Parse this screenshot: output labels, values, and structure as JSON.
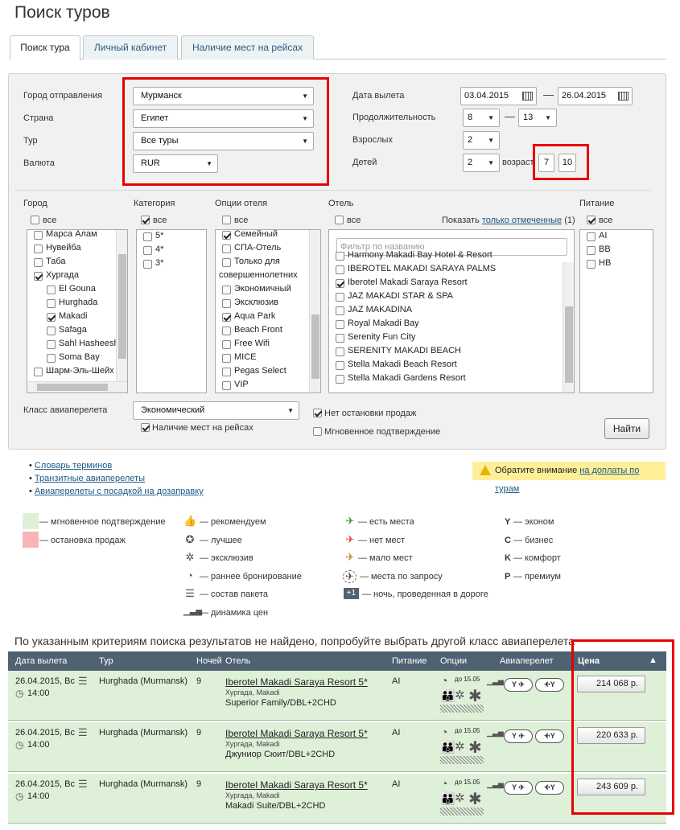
{
  "page": {
    "title": "Поиск туров"
  },
  "tabs": [
    "Поиск тура",
    "Личный кабинет",
    "Наличие мест на рейсах"
  ],
  "form": {
    "city_label": "Город отправления",
    "city_value": "Мурманск",
    "country_label": "Страна",
    "country_value": "Египет",
    "tour_label": "Тур",
    "tour_value": "Все туры",
    "currency_label": "Валюта",
    "currency_value": "RUR",
    "date_label": "Дата вылета",
    "date_from": "03.04.2015",
    "date_to": "26.04.2015",
    "duration_label": "Продолжительность",
    "duration_from": "8",
    "duration_to": "13",
    "adults_label": "Взрослых",
    "adults_value": "2",
    "children_label": "Детей",
    "children_value": "2",
    "age_label": "возраст",
    "age1": "7",
    "age2": "10",
    "dash": "—"
  },
  "filters": {
    "city": {
      "label": "Город",
      "all": "все",
      "items": [
        "Марса Алам",
        "Нувейба",
        "Таба",
        "Хургада",
        "El Gouna",
        "Hurghada",
        "Makadi",
        "Safaga",
        "Sahl Hasheesh",
        "Soma Bay",
        "Шарм-Эль-Шейх"
      ],
      "checked": [
        false,
        false,
        false,
        true,
        false,
        false,
        true,
        false,
        false,
        false,
        false
      ]
    },
    "category": {
      "label": "Категория",
      "all": "все",
      "items": [
        "5*",
        "4*",
        "3*"
      ],
      "checked": [
        false,
        false,
        false
      ]
    },
    "options": {
      "label": "Опции отеля",
      "all": "все",
      "items": [
        "Семейный",
        "СПА-Отель",
        "Только для",
        "совершеннолетних",
        "Экономичный",
        "Эксклюзив",
        "Aqua Park",
        "Beach Front",
        "Free Wifi",
        "MICE",
        "Pegas Select",
        "VIP"
      ],
      "checked": [
        true,
        false,
        false,
        false,
        false,
        false,
        true,
        false,
        false,
        false,
        false,
        false
      ]
    },
    "hotel": {
      "label": "Отель",
      "all": "все",
      "show_prefix": "Показать",
      "show_link": "только отмеченные",
      "show_count": "(1)",
      "filter_placeholder": "Фильтр по названию",
      "items": [
        "Harmony Makadi Bay Hotel & Resort",
        "IBEROTEL MAKADI SARAYA PALMS",
        "Iberotel Makadi Saraya Resort",
        "JAZ MAKADI STAR & SPA",
        "JAZ MAKADINA",
        "Royal Makadi Bay",
        "Serenity Fun City",
        "SERENITY MAKADI BEACH",
        "Stella Makadi Beach Resort",
        "Stella Makadi Gardens Resort"
      ],
      "checked": [
        false,
        false,
        true,
        false,
        false,
        false,
        false,
        false,
        false,
        false
      ]
    },
    "meal": {
      "label": "Питание",
      "all": "все",
      "items": [
        "AI",
        "BB",
        "HB"
      ],
      "checked": [
        false,
        false,
        false
      ]
    }
  },
  "flight": {
    "label": "Класс авиаперелета",
    "value": "Экономический",
    "availability": "Наличие мест на рейсах",
    "no_stop": "Нет остановки продаж",
    "instant": "Мгновенное подтверждение",
    "find": "Найти"
  },
  "links": [
    "Словарь терминов",
    "Транзитные авиаперелеты",
    "Авиаперелеты с посадкой на дозаправку"
  ],
  "notice": {
    "prefix": "Обратите внимание",
    "link": "на доплаты по турам"
  },
  "legend": {
    "instant": "— мгновенное подтверждение",
    "stop": "— остановка продаж",
    "recommend": "— рекомендуем",
    "best": "— лучшее",
    "exclusive": "— эксклюзив",
    "early": "— раннее бронирование",
    "package": "— состав пакета",
    "dynamics": "— динамика цен",
    "seats": "— есть места",
    "noseats": "— нет мест",
    "few": "— мало мест",
    "request": "— места по запросу",
    "night_badge": "+1",
    "night": "— ночь, проведенная в дороге",
    "y": "Y",
    "y_t": "— эконом",
    "c": "C",
    "c_t": "— бизнес",
    "k": "K",
    "k_t": "— комфорт",
    "p": "P",
    "p_t": "— премиум",
    "colors": {
      "instant": "#dff0d8",
      "stop": "#f7b5b8"
    }
  },
  "results": {
    "message": "По указанным критериям поиска результатов не найдено, попробуйте выбрать другой класс авиаперелета",
    "headers": [
      "Дата вылета",
      "Тур",
      "Ночей",
      "Отель",
      "Питание",
      "Опции",
      "Авиаперелет",
      "Цена"
    ],
    "sort_arrow": "▲",
    "rows": [
      {
        "date": "26.04.2015, Вс",
        "time": "14:00",
        "tour": "Hurghada (Murmansk)",
        "nights": "9",
        "hotel": "Iberotel Makadi Saraya Resort 5*",
        "region": "Хургада, Makadi",
        "room": "Superior Family/DBL+2CHD",
        "meal": "AI",
        "early": "до 15.05",
        "class1": "Y",
        "class2": "Y",
        "price": "214 068 р."
      },
      {
        "date": "26.04.2015, Вс",
        "time": "14:00",
        "tour": "Hurghada (Murmansk)",
        "nights": "9",
        "hotel": "Iberotel Makadi Saraya Resort 5*",
        "region": "Хургада, Makadi",
        "room": "Джуниор Сюит/DBL+2CHD",
        "meal": "AI",
        "early": "до 15.05",
        "class1": "Y",
        "class2": "Y",
        "price": "220 633 р."
      },
      {
        "date": "26.04.2015, Вс",
        "time": "14:00",
        "tour": "Hurghada (Murmansk)",
        "nights": "9",
        "hotel": "Iberotel Makadi Saraya Resort 5*",
        "region": "Хургада, Makadi",
        "room": "Makadi Suite/DBL+2CHD",
        "meal": "AI",
        "early": "до 15.05",
        "class1": "Y",
        "class2": "Y",
        "price": "243 609 р."
      }
    ]
  }
}
